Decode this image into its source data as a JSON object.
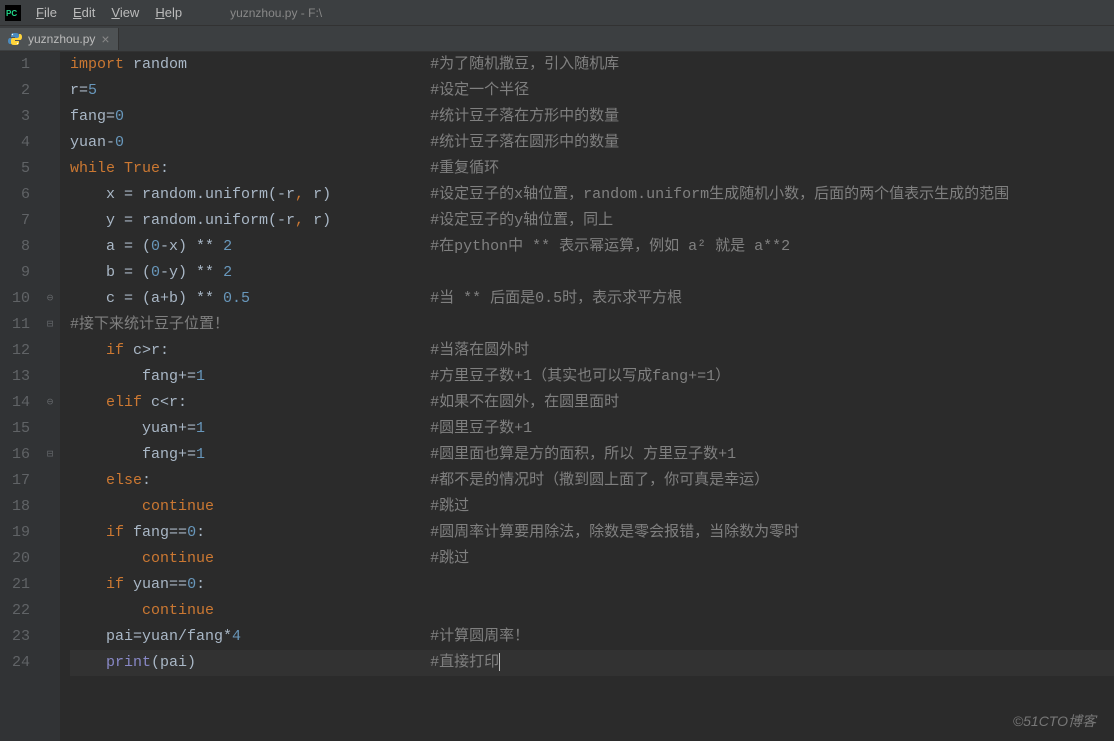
{
  "window": {
    "path": "yuznzhou.py - F:\\"
  },
  "menu": {
    "file": "File",
    "edit": "Edit",
    "view": "View",
    "help": "Help"
  },
  "tab": {
    "name": "yuznzhou.py"
  },
  "code": {
    "lines": [
      {
        "n": 1,
        "tokens": [
          {
            "t": "kw",
            "v": "import"
          },
          {
            "t": "sp",
            "v": " "
          },
          {
            "t": "ident",
            "v": "random"
          }
        ],
        "comment": "#为了随机撒豆，引入随机库"
      },
      {
        "n": 2,
        "tokens": [
          {
            "t": "ident",
            "v": "r"
          },
          {
            "t": "ident",
            "v": "="
          },
          {
            "t": "num",
            "v": "5"
          }
        ],
        "comment": "#设定一个半径"
      },
      {
        "n": 3,
        "tokens": [
          {
            "t": "ident",
            "v": "fang"
          },
          {
            "t": "ident",
            "v": "="
          },
          {
            "t": "num",
            "v": "0"
          }
        ],
        "comment": "#统计豆子落在方形中的数量"
      },
      {
        "n": 4,
        "tokens": [
          {
            "t": "ident",
            "v": "yuan"
          },
          {
            "t": "ident",
            "v": "-"
          },
          {
            "t": "num",
            "v": "0"
          }
        ],
        "comment": "#统计豆子落在圆形中的数量"
      },
      {
        "n": 5,
        "tokens": [
          {
            "t": "kw",
            "v": "while"
          },
          {
            "t": "sp",
            "v": " "
          },
          {
            "t": "kw",
            "v": "True"
          },
          {
            "t": "ident",
            "v": ":"
          }
        ],
        "comment": "#重复循环"
      },
      {
        "n": 6,
        "indent": 4,
        "tokens": [
          {
            "t": "ident",
            "v": "x = random.uniform(-r"
          },
          {
            "t": "kw",
            "v": ","
          },
          {
            "t": "ident",
            "v": " r)"
          }
        ],
        "comment": "#设定豆子的x轴位置，random.uniform生成随机小数，后面的两个值表示生成的范围"
      },
      {
        "n": 7,
        "indent": 4,
        "tokens": [
          {
            "t": "ident",
            "v": "y = random.uniform(-r"
          },
          {
            "t": "kw",
            "v": ","
          },
          {
            "t": "ident",
            "v": " r)"
          }
        ],
        "comment": "#设定豆子的y轴位置，同上"
      },
      {
        "n": 8,
        "indent": 4,
        "tokens": [
          {
            "t": "ident",
            "v": "a = ("
          },
          {
            "t": "num",
            "v": "0"
          },
          {
            "t": "ident",
            "v": "-x) ** "
          },
          {
            "t": "num",
            "v": "2"
          }
        ],
        "comment": "#在python中 ** 表示幂运算，例如 a² 就是 a**2"
      },
      {
        "n": 9,
        "indent": 4,
        "tokens": [
          {
            "t": "ident",
            "v": "b = ("
          },
          {
            "t": "num",
            "v": "0"
          },
          {
            "t": "ident",
            "v": "-y) ** "
          },
          {
            "t": "num",
            "v": "2"
          }
        ],
        "comment": ""
      },
      {
        "n": 10,
        "indent": 4,
        "tokens": [
          {
            "t": "ident",
            "v": "c = (a+b) ** "
          },
          {
            "t": "num",
            "v": "0.5"
          }
        ],
        "comment": "#当 ** 后面是0.5时，表示求平方根"
      },
      {
        "n": 11,
        "tokens": [
          {
            "t": "comment",
            "v": "#接下来统计豆子位置！"
          }
        ],
        "comment": ""
      },
      {
        "n": 12,
        "indent": 4,
        "tokens": [
          {
            "t": "kw",
            "v": "if"
          },
          {
            "t": "sp",
            "v": " "
          },
          {
            "t": "ident",
            "v": "c>r:"
          }
        ],
        "comment": "#当落在圆外时"
      },
      {
        "n": 13,
        "indent": 8,
        "tokens": [
          {
            "t": "ident",
            "v": "fang+="
          },
          {
            "t": "num",
            "v": "1"
          }
        ],
        "comment": "#方里豆子数+1（其实也可以写成fang+=1）"
      },
      {
        "n": 14,
        "indent": 4,
        "tokens": [
          {
            "t": "kw",
            "v": "elif"
          },
          {
            "t": "sp",
            "v": " "
          },
          {
            "t": "ident",
            "v": "c<r:"
          }
        ],
        "comment": "#如果不在圆外，在圆里面时"
      },
      {
        "n": 15,
        "indent": 8,
        "tokens": [
          {
            "t": "ident",
            "v": "yuan+="
          },
          {
            "t": "num",
            "v": "1"
          }
        ],
        "comment": "#圆里豆子数+1"
      },
      {
        "n": 16,
        "indent": 8,
        "tokens": [
          {
            "t": "ident",
            "v": "fang+="
          },
          {
            "t": "num",
            "v": "1"
          }
        ],
        "comment": "#圆里面也算是方的面积，所以 方里豆子数+1"
      },
      {
        "n": 17,
        "indent": 4,
        "tokens": [
          {
            "t": "kw",
            "v": "else"
          },
          {
            "t": "ident",
            "v": ":"
          }
        ],
        "comment": "#都不是的情况时（撒到圆上面了，你可真是幸运）"
      },
      {
        "n": 18,
        "indent": 8,
        "tokens": [
          {
            "t": "kw",
            "v": "continue"
          }
        ],
        "comment": "#跳过"
      },
      {
        "n": 19,
        "indent": 4,
        "tokens": [
          {
            "t": "kw",
            "v": "if"
          },
          {
            "t": "sp",
            "v": " "
          },
          {
            "t": "ident",
            "v": "fang=="
          },
          {
            "t": "num",
            "v": "0"
          },
          {
            "t": "ident",
            "v": ":"
          }
        ],
        "comment": "#圆周率计算要用除法，除数是零会报错，当除数为零时"
      },
      {
        "n": 20,
        "indent": 8,
        "tokens": [
          {
            "t": "kw",
            "v": "continue"
          }
        ],
        "comment": "#跳过"
      },
      {
        "n": 21,
        "indent": 4,
        "tokens": [
          {
            "t": "kw",
            "v": "if"
          },
          {
            "t": "sp",
            "v": " "
          },
          {
            "t": "ident",
            "v": "yuan=="
          },
          {
            "t": "num",
            "v": "0"
          },
          {
            "t": "ident",
            "v": ":"
          }
        ],
        "comment": ""
      },
      {
        "n": 22,
        "indent": 8,
        "tokens": [
          {
            "t": "kw",
            "v": "continue"
          }
        ],
        "comment": ""
      },
      {
        "n": 23,
        "indent": 4,
        "tokens": [
          {
            "t": "ident",
            "v": "pai=yuan/fang*"
          },
          {
            "t": "num",
            "v": "4"
          }
        ],
        "comment": "#计算圆周率！"
      },
      {
        "n": 24,
        "indent": 4,
        "tokens": [
          {
            "t": "builtin",
            "v": "print"
          },
          {
            "t": "ident",
            "v": "(pai)"
          }
        ],
        "comment": "#直接打印",
        "current": true
      }
    ]
  },
  "fold_markers": {
    "10": "⊖",
    "11": "⊟",
    "14": "⊖",
    "16": "⊟"
  },
  "watermark": "©51CTO博客"
}
